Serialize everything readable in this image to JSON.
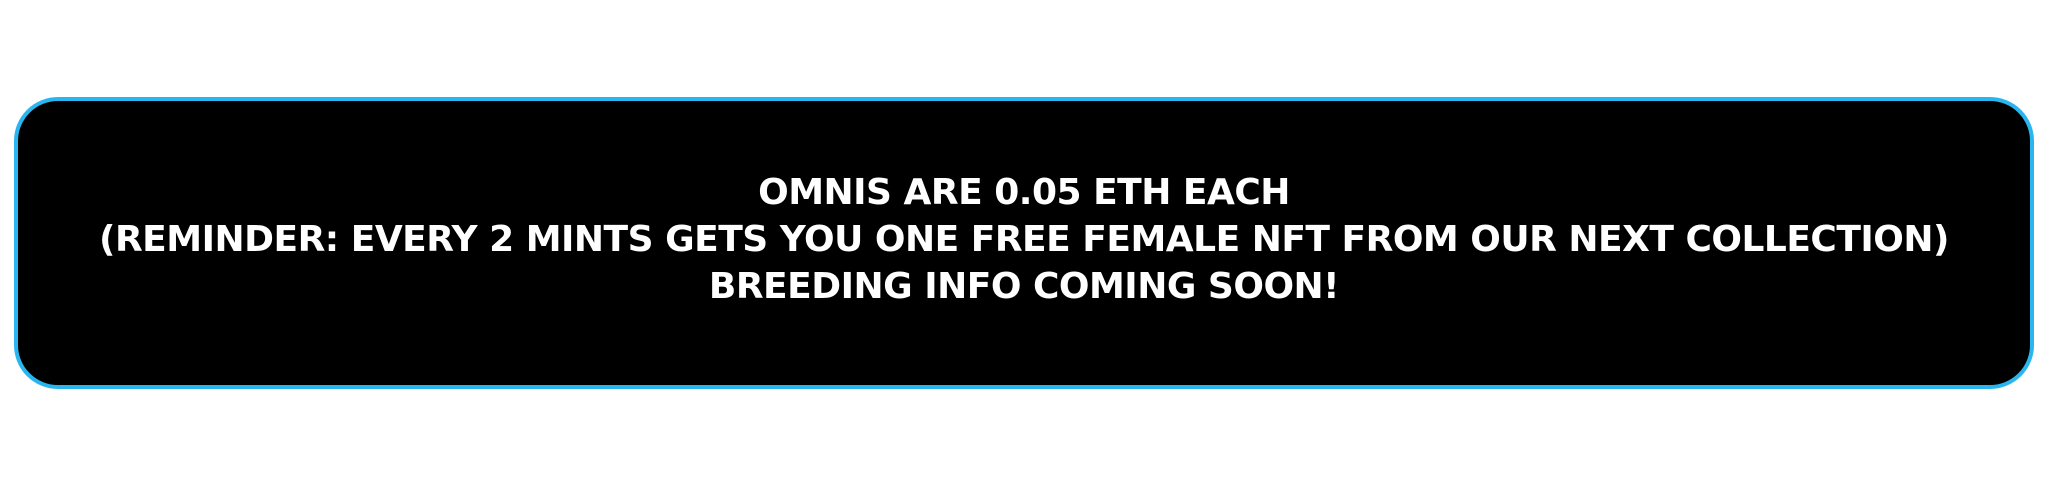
{
  "banner": {
    "colors": {
      "background": "#000000",
      "border": "#29b6f0",
      "text": "#ffffff"
    },
    "lines": [
      "OMNIS ARE 0.05 ETH EACH",
      "(REMINDER: EVERY 2 MINTS GETS YOU ONE FREE FEMALE NFT FROM OUR NEXT COLLECTION)",
      "BREEDING INFO COMING SOON!"
    ]
  }
}
